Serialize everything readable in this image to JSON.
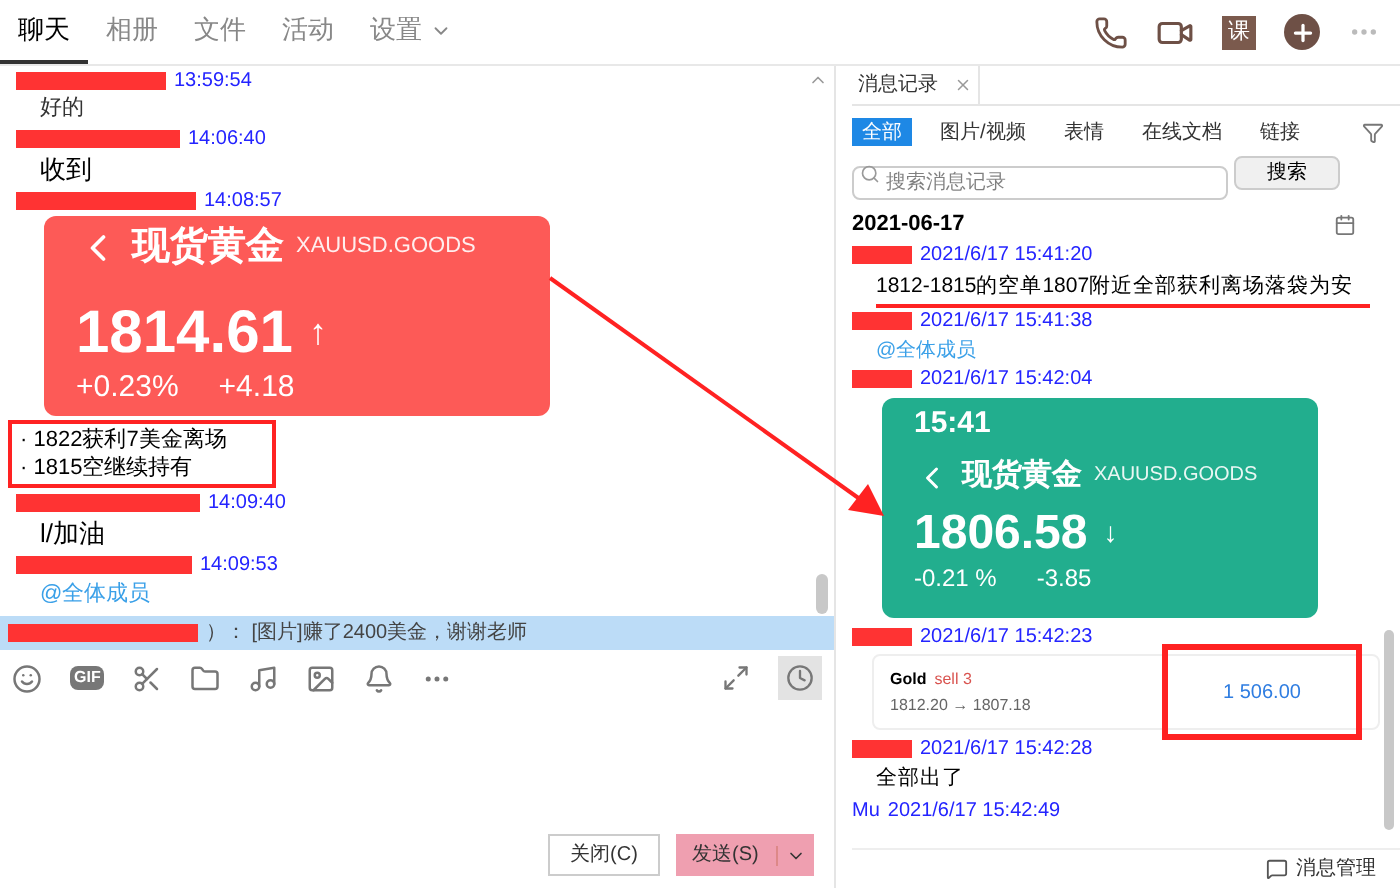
{
  "tabs": [
    {
      "label": "聊天",
      "selected": true,
      "has_menu": false
    },
    {
      "label": "相册",
      "selected": false,
      "has_menu": false
    },
    {
      "label": "文件",
      "selected": false,
      "has_menu": false
    },
    {
      "label": "活动",
      "selected": false,
      "has_menu": false
    },
    {
      "label": "设置",
      "selected": false,
      "has_menu": true
    }
  ],
  "header_actions": {
    "course_label": "课"
  },
  "messages": [
    {
      "kind": "small",
      "time": "13:59:54",
      "text": "好的"
    },
    {
      "kind": "text",
      "time": "14:06:40",
      "text": "收到"
    },
    {
      "kind": "quote",
      "time": "14:08:57",
      "card": {
        "title": "现货黄金",
        "code": "XAUUSD.GOODS",
        "price": "1814.61",
        "arrow": "↑",
        "change_pct": "+0.23%",
        "change": "+4.18"
      },
      "lines": [
        "· 1822获利7美金离场",
        "· 1815空继续持有"
      ]
    },
    {
      "kind": "text",
      "time": "14:09:40",
      "text": "l/加油"
    },
    {
      "kind": "mention",
      "time": "14:09:53",
      "text": "@全体成员"
    }
  ],
  "notification": "）：  [图片]赚了2400美金，谢谢老师",
  "toolbar": {
    "gif_label": "GIF"
  },
  "buttons": {
    "close": "关闭(C)",
    "send": "发送(S)"
  },
  "history": {
    "tab": "消息记录",
    "filters": [
      {
        "label": "全部",
        "selected": true
      },
      {
        "label": "图片/视频",
        "selected": false
      },
      {
        "label": "表情",
        "selected": false
      },
      {
        "label": "在线文档",
        "selected": false
      },
      {
        "label": "链接",
        "selected": false
      }
    ],
    "search_placeholder": "搜索消息记录",
    "search_button": "搜索",
    "date": "2021-06-17",
    "records": [
      {
        "kind": "text",
        "time": "2021/6/17 15:41:20",
        "text": "1812-1815的空单1807附近全部获利离场落袋为安",
        "underlined": true
      },
      {
        "kind": "mention",
        "time": "2021/6/17 15:41:38",
        "text": "@全体成员"
      },
      {
        "kind": "quote",
        "time": "2021/6/17 15:42:04",
        "card": {
          "clock": "15:41",
          "title": "现货黄金",
          "code": "XAUUSD.GOODS",
          "price": "1806.58",
          "arrow": "↓",
          "change_pct": "-0.21 %",
          "change": "-3.85"
        }
      },
      {
        "kind": "trade",
        "time": "2021/6/17 15:42:23",
        "trade": {
          "symbol": "Gold",
          "side": "sell 3",
          "prices": "1812.20 → 1807.18",
          "profit": "1 506.00"
        }
      },
      {
        "kind": "text",
        "time": "2021/6/17 15:42:28",
        "text": "全部出了",
        "underlined": false
      },
      {
        "kind": "time_only",
        "sender": "Mu",
        "time": "2021/6/17 15:42:49"
      }
    ],
    "manage": "消息管理"
  }
}
